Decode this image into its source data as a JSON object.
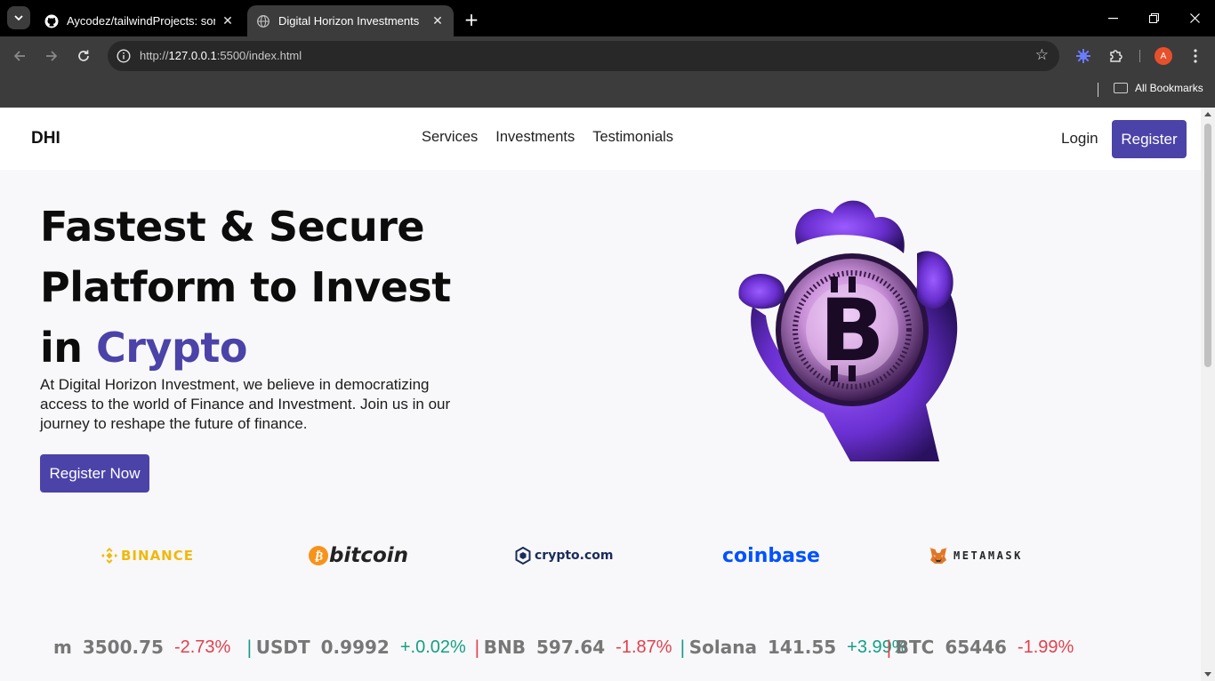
{
  "browser": {
    "tabs": [
      {
        "title": "Aycodez/tailwindProjects: some",
        "icon": "github-icon",
        "active": false
      },
      {
        "title": "Digital Horizon Investments",
        "icon": "globe-icon",
        "active": true
      }
    ],
    "url_prefix": "http://",
    "url_host": "127.0.0.1",
    "url_rest": ":5500/index.html",
    "bookmarks_label": "All Bookmarks",
    "profile_initial": "A"
  },
  "site": {
    "logo": "DHI",
    "nav": [
      "Services",
      "Investments",
      "Testimonials"
    ],
    "login": "Login",
    "register": "Register",
    "accent_color": "#4b43a8"
  },
  "hero": {
    "headline_line1": "Fastest & Secure",
    "headline_line2": "Platform to Invest",
    "headline_line3_prefix": "in ",
    "headline_line3_accent": "Crypto",
    "intro": "At Digital Horizon Investment, we believe in democratizing access to the world of Finance and Investment. Join us in our journey to reshape the future of finance.",
    "cta": "Register Now"
  },
  "partners": {
    "binance": "BINANCE",
    "bitcoin": "bitcoin",
    "crypto": "crypto.com",
    "coinbase": "coinbase",
    "metamask": "METAMASK"
  },
  "ticker": [
    {
      "sep": "",
      "symbol": "m",
      "price": "3500.75",
      "change": "-2.73%",
      "direction": "down"
    },
    {
      "sep": "|",
      "symbol": "USDT",
      "price": "0.9992",
      "change": "+.0.02%",
      "direction": "up"
    },
    {
      "sep": "|",
      "symbol": "BNB",
      "price": "597.64",
      "change": "-1.87%",
      "direction": "down"
    },
    {
      "sep": "|",
      "symbol": "Solana",
      "price": "141.55",
      "change": "+3.99%",
      "direction": "up"
    },
    {
      "sep": "|",
      "symbol": "BTC",
      "price": "65446",
      "change": "-1.99%",
      "direction": "down"
    }
  ]
}
